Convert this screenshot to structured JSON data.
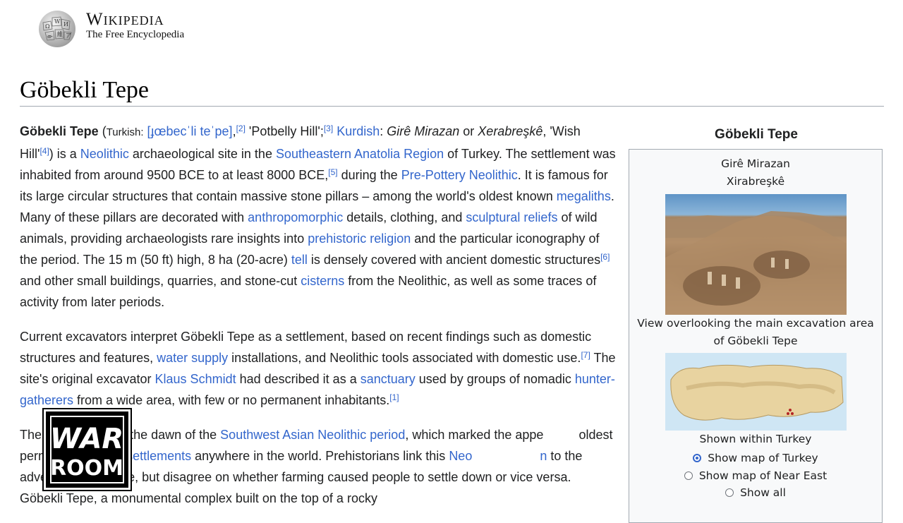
{
  "header": {
    "wordmark": "Wikipedia",
    "tagline": "The Free Encyclopedia"
  },
  "title": "Göbekli Tepe",
  "article": {
    "p1": {
      "bold": "Göbekli Tepe",
      "open_paren": " (",
      "lang1": "Turkish:",
      "ipa": "[ɟœbecˈli teˈpe]",
      "sep1": ",",
      "ref2": "[2]",
      "gloss1": " 'Potbelly Hill';",
      "ref3": "[3]",
      "lang2": "Kurdish",
      "colon": ": ",
      "kur1": "Girê Mirazan",
      "or": " or ",
      "kur2": "Xerabreşkê",
      "gloss2": ", 'Wish Hill'",
      "ref4": "[4]",
      "t1": ") is a ",
      "l_neolithic": "Neolithic",
      "t2": " archaeological site in the ",
      "l_region": "Southeastern Anatolia Region",
      "t3": " of Turkey. The settlement was inhabited from around 9500 BCE to at least 8000 BCE,",
      "ref5": "[5]",
      "t4": " during the ",
      "l_ppn": "Pre-Pottery Neolithic",
      "t5": ". It is famous for its large circular structures that contain massive stone pillars – among the world's oldest known ",
      "l_megaliths": "megaliths",
      "t6": ". Many of these pillars are decorated with ",
      "l_anthro": "anthropomorphic",
      "t7": " details, clothing, and ",
      "l_reliefs": "sculptural reliefs",
      "t8": " of wild animals, providing archaeologists rare insights into ",
      "l_religion": "prehistoric religion",
      "t9": " and the particular iconography of the period. The 15 m (50 ft) high, 8 ha (20-acre) ",
      "l_tell": "tell",
      "t10": " is densely covered with ancient domestic structures",
      "ref6": "[6]",
      "t11": " and other small buildings, quarries, and stone-cut ",
      "l_cisterns": "cisterns",
      "t12": " from the Neolithic, as well as some traces of activity from later periods."
    },
    "p2": {
      "t1": "Current excavators interpret Göbekli Tepe as a settlement, based on recent findings such as domestic structures and features, ",
      "l_water": "water supply",
      "t2": " installations, and Neolithic tools associated with domestic use.",
      "ref7": "[7]",
      "t3": " The site's original excavator ",
      "l_schmidt": "Klaus Schmidt",
      "t4": " had described it as a ",
      "l_sanctuary": "sanctuary",
      "t5": " used by groups of nomadic ",
      "l_hunter": "hunter-gatherers",
      "t6": " from a wide area, with few or no permanent inhabitants.",
      "ref1": "[1]"
    },
    "p3": {
      "t1": "The ",
      "t1b": "sed at the dawn of the ",
      "l_period": "Southwest Asian Neolithic period",
      "t2": ", which marked the appe",
      "t2b": "oldest permanent ",
      "l_settlements": "human settlements",
      "t3": " anywhere in the world. Prehistorians link this ",
      "l_neo": "Neo",
      "l_neo_tail": "n",
      "t4": " to the advent of agriculture, but disagree on whether farming caused people to settle down or vice versa. Göbekli Tepe, a monumental complex built on the top of a rocky"
    }
  },
  "infobox": {
    "caption": "Göbekli Tepe",
    "alt_name_1": "Girê Mirazan",
    "alt_name_2": "Xirabreşkê",
    "photo_caption": "View overlooking the main excavation area of Göbekli Tepe",
    "map_caption": "Shown within Turkey",
    "radio_options": [
      {
        "label": "Show map of Turkey",
        "checked": true
      },
      {
        "label": "Show map of Near East",
        "checked": false
      },
      {
        "label": "Show all",
        "checked": false
      }
    ]
  },
  "watermark": {
    "line1": "WAR",
    "line2": "ROOM"
  },
  "colors": {
    "link": "#3366cc",
    "text": "#202122",
    "infobox_bg": "#f8f9fa",
    "marker": "#b32424"
  }
}
